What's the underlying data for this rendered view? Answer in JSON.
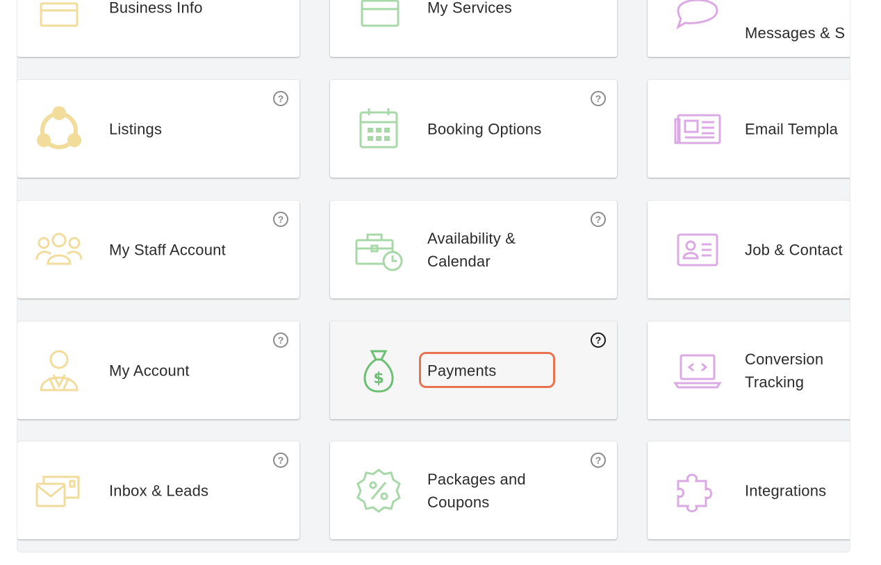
{
  "colors": {
    "yellow": "#f1dc9c",
    "green": "#a8d8a8",
    "green_strong": "#6cbf73",
    "purple": "#dba9e3",
    "highlight": "#e8734f"
  },
  "help_glyph": "?",
  "cards": [
    {
      "id": "business-info",
      "label": "Business Info",
      "icon": "business-card-icon"
    },
    {
      "id": "my-services",
      "label": "My Services",
      "icon": "box-icon"
    },
    {
      "id": "messages",
      "label": "Messages & S",
      "icon": "chat-bubble-icon"
    },
    {
      "id": "listings",
      "label": "Listings",
      "icon": "network-circle-icon"
    },
    {
      "id": "booking-options",
      "label": "Booking Options",
      "icon": "calendar-grid-icon"
    },
    {
      "id": "email-templates",
      "label": "Email Templa",
      "icon": "newspaper-icon"
    },
    {
      "id": "my-staff-account",
      "label": "My Staff Account",
      "icon": "group-users-icon"
    },
    {
      "id": "availability-calendar",
      "label": "Availability &\nCalendar",
      "icon": "briefcase-clock-icon"
    },
    {
      "id": "job-contact",
      "label": "Job & Contact",
      "icon": "id-card-icon"
    },
    {
      "id": "my-account",
      "label": "My Account",
      "icon": "user-suit-icon"
    },
    {
      "id": "payments",
      "label": "Payments",
      "icon": "money-bag-icon"
    },
    {
      "id": "conversion-tracking",
      "label": "Conversion\nTracking",
      "icon": "laptop-code-icon"
    },
    {
      "id": "inbox-leads",
      "label": "Inbox & Leads",
      "icon": "mail-stack-icon"
    },
    {
      "id": "packages-coupons",
      "label": "Packages and\nCoupons",
      "icon": "percent-badge-icon"
    },
    {
      "id": "integrations",
      "label": "Integrations",
      "icon": "puzzle-icon"
    }
  ]
}
